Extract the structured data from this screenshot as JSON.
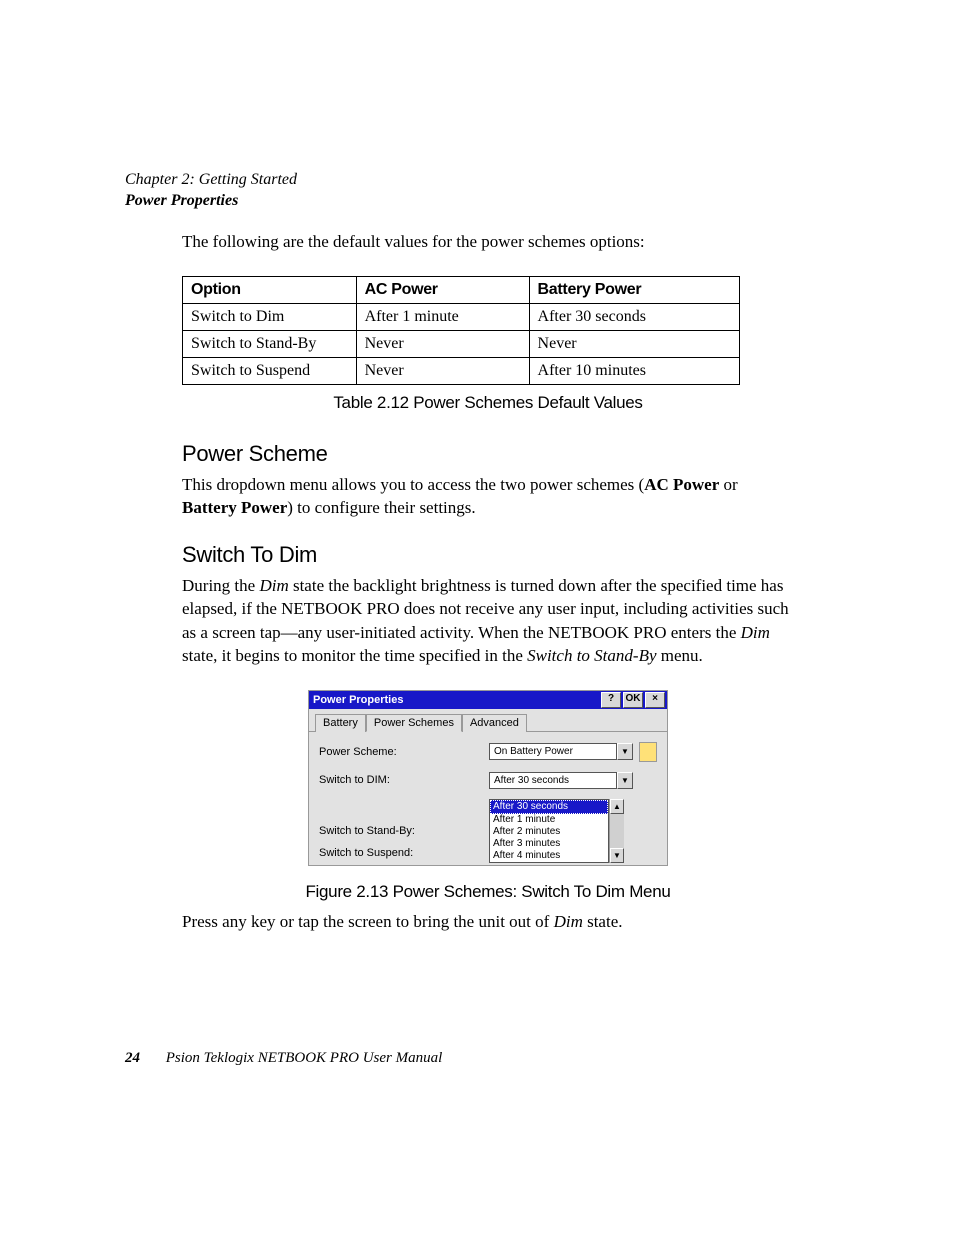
{
  "header": {
    "chapter": "Chapter 2:  Getting Started",
    "section": "Power Properties"
  },
  "intro": "The following are the default values for the power schemes options:",
  "table": {
    "headers": [
      "Option",
      "AC Power",
      "Battery Power"
    ],
    "rows": [
      [
        "Switch to Dim",
        "After 1 minute",
        "After 30 seconds"
      ],
      [
        "Switch to Stand-By",
        "Never",
        "Never"
      ],
      [
        "Switch to Suspend",
        "Never",
        "After 10 minutes"
      ]
    ],
    "caption": "Table 2.12 Power Schemes Default Values"
  },
  "sections": {
    "power_scheme": {
      "title": "Power Scheme",
      "body_parts": [
        "This dropdown menu allows you to access the two power schemes (",
        "AC Power",
        " or ",
        "Battery Power",
        ") to configure their settings."
      ]
    },
    "switch_dim": {
      "title": "Switch To Dim",
      "body_parts": [
        "During the ",
        "Dim",
        " state the backlight brightness is turned down after the specified time has elapsed, if the NETBOOK PRO does not receive any user input, including activities such as a screen tap—any user-initiated activity. When the NETBOOK PRO enters the ",
        "Dim",
        " state, it begins to monitor the time specified in the ",
        "Switch to Stand-By",
        " menu."
      ]
    }
  },
  "dialog": {
    "title": "Power Properties",
    "buttons": {
      "help": "?",
      "ok": "OK",
      "close": "×"
    },
    "tabs": [
      "Battery",
      "Power Schemes",
      "Advanced"
    ],
    "active_tab": 1,
    "labels": {
      "scheme": "Power Scheme:",
      "dim": "Switch to DIM:",
      "standby": "Switch to Stand-By:",
      "suspend": "Switch to Suspend:"
    },
    "scheme_value": "On Battery Power",
    "dim_value": "After 30 seconds",
    "dropdown_items": [
      "After 30 seconds",
      "After 1 minute",
      "After 2 minutes",
      "After 3 minutes",
      "After 4 minutes"
    ],
    "selected_dropdown_index": 0
  },
  "figure_caption": "Figure 2.13 Power Schemes: Switch To Dim Menu",
  "post_figure_parts": [
    "Press any key or tap the screen to bring the unit out of ",
    "Dim",
    " state."
  ],
  "footer": {
    "page": "24",
    "text": "Psion Teklogix NETBOOK PRO User Manual"
  }
}
